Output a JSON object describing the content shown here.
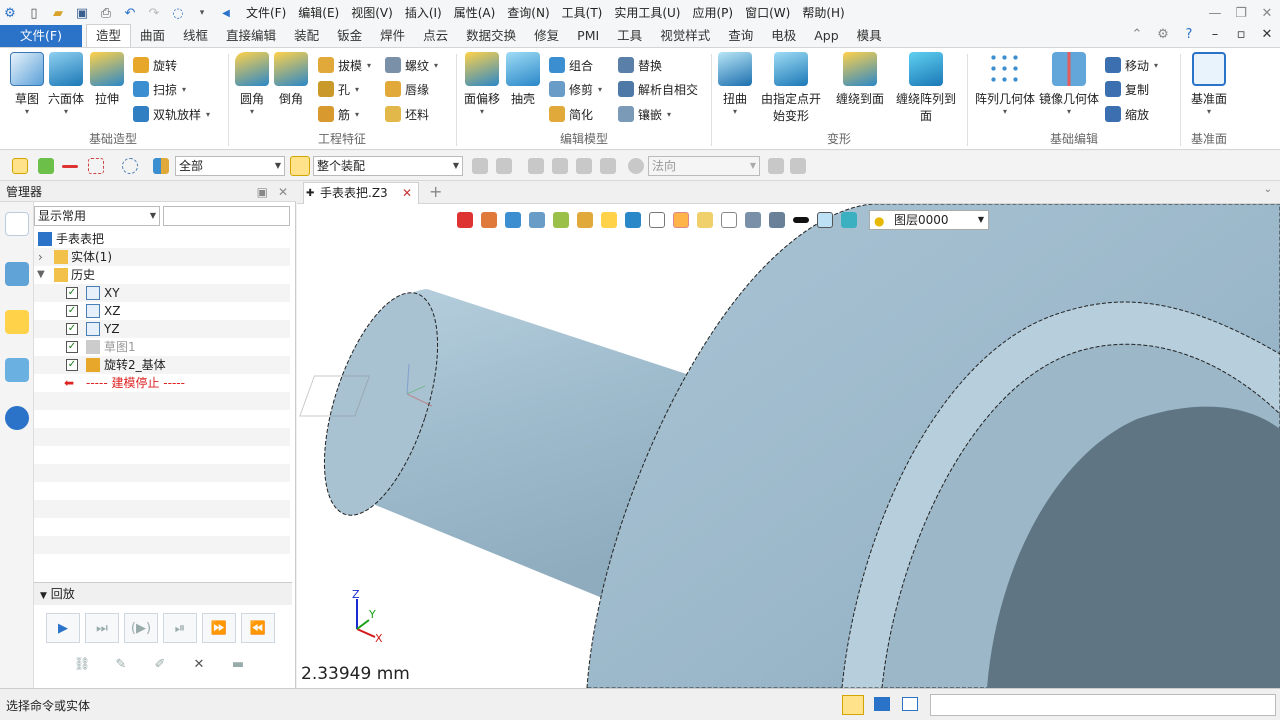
{
  "title_menu": [
    "文件(F)",
    "编辑(E)",
    "视图(V)",
    "插入(I)",
    "属性(A)",
    "查询(N)",
    "工具(T)",
    "实用工具(U)",
    "应用(P)",
    "窗口(W)",
    "帮助(H)"
  ],
  "tabs": {
    "file": "文件(F)",
    "items": [
      "造型",
      "曲面",
      "线框",
      "直接编辑",
      "装配",
      "钣金",
      "焊件",
      "点云",
      "数据交换",
      "修复",
      "PMI",
      "工具",
      "视觉样式",
      "查询",
      "电极",
      "App",
      "模具"
    ]
  },
  "ribbon": {
    "g1": {
      "label": "基础造型",
      "sketch": "草图",
      "hexahedron": "六面体",
      "extrude": "拉伸",
      "revolve": "旋转",
      "sweep": "扫掠",
      "dual_rail": "双轨放样"
    },
    "g2": {
      "label": "工程特征",
      "fillet": "圆角",
      "chamfer": "倒角",
      "draft": "拔模",
      "hole": "孔",
      "rib": "筋",
      "thread": "螺纹",
      "lip": "唇缘",
      "blank": "坯料"
    },
    "g3": {
      "label": "编辑模型",
      "face_offset": "面偏移",
      "shell": "抽壳",
      "combine": "组合",
      "trim": "修剪",
      "simplify": "简化",
      "replace": "替换",
      "self_intersect": "解析自相交",
      "inlay": "镶嵌"
    },
    "g4": {
      "label": "变形",
      "twist": "扭曲",
      "deform_a": "由指定点开",
      "deform_b": "始变形",
      "wrap_a": "缠绕到面",
      "wrap_arr_a": "缠绕阵列到",
      "wrap_arr_b": "面"
    },
    "g5": {
      "label": "基础编辑",
      "pattern": "阵列几何体",
      "mirror": "镜像几何体",
      "move": "移动",
      "copy": "复制",
      "scale": "缩放"
    },
    "g6": {
      "label": "基准面",
      "datum": "基准面"
    }
  },
  "toolbar2": {
    "filter": "全部",
    "scope": "整个装配",
    "normal_placeholder": "法向"
  },
  "manager": {
    "title": "管理器",
    "display": "显示常用",
    "tree": [
      {
        "label": "手表表把"
      },
      {
        "label": "实体(1)"
      },
      {
        "label": "历史"
      },
      {
        "label": "XY"
      },
      {
        "label": "XZ"
      },
      {
        "label": "YZ"
      },
      {
        "label": "草图1"
      },
      {
        "label": "旋转2_基体"
      },
      {
        "label": "----- 建模停止 -----"
      }
    ],
    "replay": "回放"
  },
  "doc_tab": "手表表把.Z3",
  "layer": "图层0000",
  "measure": "2.33949 mm",
  "status": "选择命令或实体",
  "triad": {
    "x": "X",
    "y": "Y",
    "z": "Z"
  },
  "colors": {
    "accent": "#2b72c9",
    "part": "#9fbccd",
    "part_dark": "#5f7583"
  }
}
